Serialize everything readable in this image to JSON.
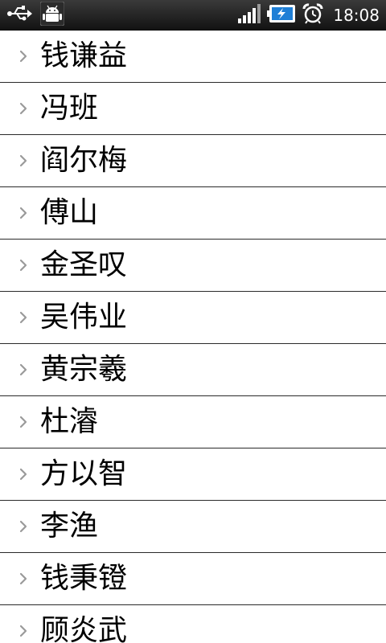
{
  "status_bar": {
    "time": "18:08",
    "icons": [
      "usb-icon",
      "android-debug-icon",
      "signal-icon",
      "battery-charging-icon",
      "alarm-icon"
    ],
    "background": "#111111"
  },
  "contacts": [
    {
      "name": "钱谦益"
    },
    {
      "name": "冯班"
    },
    {
      "name": "阎尔梅"
    },
    {
      "name": "傅山"
    },
    {
      "name": "金圣叹"
    },
    {
      "name": "吴伟业"
    },
    {
      "name": "黄宗羲"
    },
    {
      "name": "杜濬"
    },
    {
      "name": "方以智"
    },
    {
      "name": "李渔"
    },
    {
      "name": "钱秉镫"
    },
    {
      "name": "顾炎武"
    }
  ],
  "colors": {
    "row_divider": "#2a2a2a",
    "chevron": "#9a9a9a",
    "text": "#000000"
  }
}
